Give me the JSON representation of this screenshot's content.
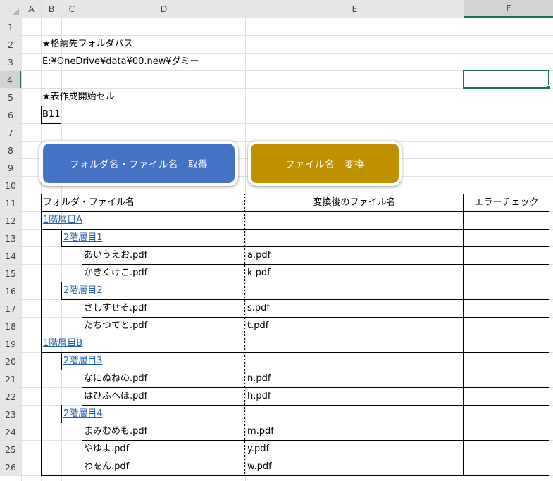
{
  "sheet": {
    "corner_label": "",
    "columns": [
      "A",
      "B",
      "C",
      "D",
      "E",
      "F"
    ],
    "rows": [
      "1",
      "2",
      "3",
      "4",
      "5",
      "6",
      "7",
      "8",
      "9",
      "10",
      "11",
      "12",
      "13",
      "14",
      "15",
      "16",
      "17",
      "18",
      "19",
      "20",
      "21",
      "22",
      "23",
      "24",
      "25",
      "26"
    ]
  },
  "settings": {
    "folder_path_label": "★格納先フォルダパス",
    "folder_path_value": "E:¥OneDrive¥data¥00.new¥ダミー",
    "start_cell_label": "★表作成開始セル",
    "start_cell_value": "B11"
  },
  "buttons": {
    "get_names": "フォルダ名・ファイル名　取得",
    "convert_names": "ファイル名　変換"
  },
  "table": {
    "headers": {
      "name": "フォルダ・ファイル名",
      "converted": "変換後のファイル名",
      "error_check": "エラーチェック"
    },
    "rows": [
      {
        "level": 1,
        "name": "1階層目A",
        "link": true,
        "converted": ""
      },
      {
        "level": 2,
        "name": "2階層目1",
        "link": true,
        "converted": ""
      },
      {
        "level": 3,
        "name": "あいうえお.pdf",
        "link": false,
        "converted": "a.pdf"
      },
      {
        "level": 3,
        "name": "かきくけこ.pdf",
        "link": false,
        "converted": "k.pdf"
      },
      {
        "level": 2,
        "name": "2階層目2",
        "link": true,
        "converted": ""
      },
      {
        "level": 3,
        "name": "さしすせそ.pdf",
        "link": false,
        "converted": "s.pdf"
      },
      {
        "level": 3,
        "name": "たちつてと.pdf",
        "link": false,
        "converted": "t.pdf"
      },
      {
        "level": 1,
        "name": "1階層目B",
        "link": true,
        "converted": ""
      },
      {
        "level": 2,
        "name": "2階層目3",
        "link": true,
        "converted": ""
      },
      {
        "level": 3,
        "name": "なにぬねの.pdf",
        "link": false,
        "converted": "n.pdf"
      },
      {
        "level": 3,
        "name": "はひふへほ.pdf",
        "link": false,
        "converted": "h.pdf"
      },
      {
        "level": 2,
        "name": "2階層目4",
        "link": true,
        "converted": ""
      },
      {
        "level": 3,
        "name": "まみむめも.pdf",
        "link": false,
        "converted": "m.pdf"
      },
      {
        "level": 3,
        "name": "やゆよ.pdf",
        "link": false,
        "converted": "y.pdf"
      },
      {
        "level": 3,
        "name": "わをん.pdf",
        "link": false,
        "converted": "w.pdf"
      }
    ]
  },
  "colors": {
    "get_button": "#4472c4",
    "convert_button": "#bf9000",
    "selection": "#217346",
    "link": "#1f5ea8"
  }
}
